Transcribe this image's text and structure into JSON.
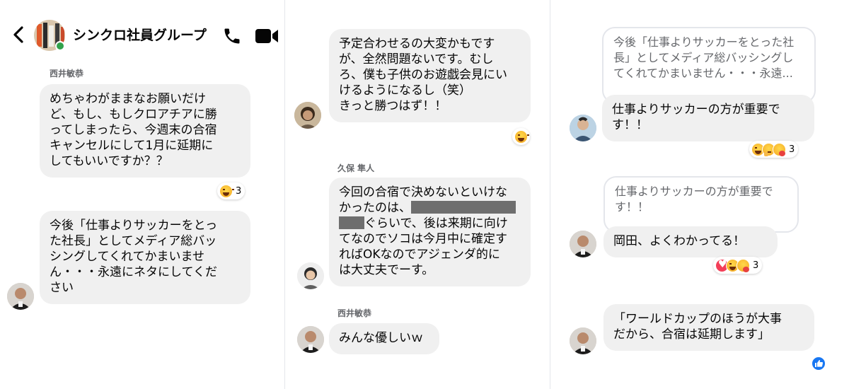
{
  "header": {
    "title": "シンクロ社員グループ"
  },
  "panel1": {
    "sender_name": "西井敏恭",
    "msg1": "めちゃわがままなお願いだけ\nど、もし、もしクロアチアに勝\nってしまったら、今週末の合宿\nキャンセルにして1月に延期に\nしてもいいですか？？",
    "msg1_reaction_count": "3",
    "msg2": "今後「仕事よりサッカーをとっ\nた社長」としてメディア総バッ\nシングしてくれてかまいませ\nん・・・永遠にネタにしてくだ\nさい"
  },
  "panel2": {
    "msg1": "予定合わせるの大変かもです\nが、全然問題ないです。むし\nろ、僕も子供のお遊戯会見にい\nけるようになるし（笑）\nきっと勝つはず！！",
    "sender2": "久保 隼人",
    "msg2_line1": "今回の合宿で決めないといけな",
    "msg2_line2": "かったのは、",
    "msg2_line3": "ぐらいで、後は来期に向け",
    "msg2_rest": "てなのでソコは今月中に確定す\nればOKなのでアジェンダ的に\nは大丈夫でーす。",
    "sender3": "西井敏恭",
    "msg3": "みんな優しいｗ"
  },
  "panel3": {
    "quote1": "今後「仕事よりサッカーをとった社\n長」としてメディア総バッシングし\nてくれてかまいません・・・永遠...",
    "msg1": "仕事よりサッカーの方が重要で\nす！！",
    "msg1_reaction_count": "3",
    "quote2": "仕事よりサッカーの方が重要で\nす！！",
    "msg2": "岡田、よくわかってる！",
    "msg2_reaction_count": "3",
    "msg3": "「ワールドカップのほうが大事\nだから、合宿は延期します」"
  },
  "colors": {
    "bubble": "#f0f0f0",
    "messenger_blue": "#1877f2",
    "online_green": "#31a24c"
  }
}
